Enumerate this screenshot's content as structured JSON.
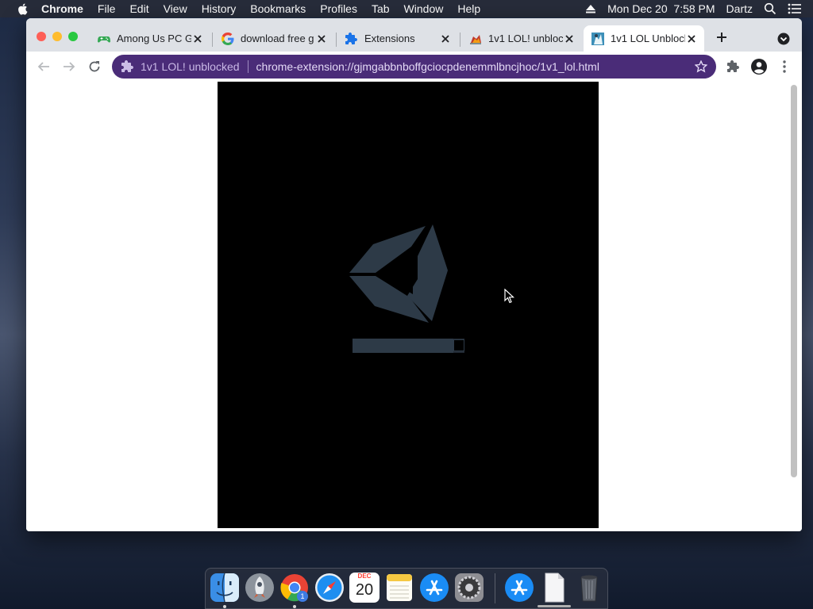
{
  "menubar": {
    "app_name": "Chrome",
    "menus": [
      "File",
      "Edit",
      "View",
      "History",
      "Bookmarks",
      "Profiles",
      "Tab",
      "Window",
      "Help"
    ],
    "clock": "Mon Dec 20  7:58 PM",
    "user": "Dartz"
  },
  "browser": {
    "tabs": [
      {
        "title": "Among Us PC G",
        "favicon": "gamepad-icon",
        "active": false
      },
      {
        "title": "download free g",
        "favicon": "google-icon",
        "active": false
      },
      {
        "title": "Extensions",
        "favicon": "puzzle-icon",
        "active": false
      },
      {
        "title": "1v1 LOL! unbloc",
        "favicon": "game-thumbnail-icon",
        "active": false
      },
      {
        "title": "1v1 LOL Unblock",
        "favicon": "game-thumbnail-icon",
        "active": true
      }
    ],
    "omnibox": {
      "chip": "1v1 LOL! unblocked",
      "url": "chrome-extension://gjmgabbnboffgciocpdenemmlbncjhoc/1v1_lol.html"
    }
  },
  "page": {
    "loader": {
      "logo": "unity-logo",
      "progress": 0.9
    }
  },
  "dock": {
    "apps": [
      "finder",
      "launchpad",
      "chrome",
      "safari",
      "calendar",
      "notes",
      "app-store",
      "system-preferences",
      "app-store-downloads",
      "document",
      "trash"
    ],
    "calendar": {
      "month": "DEC",
      "day": "20"
    },
    "chrome_badge": "1"
  },
  "colors": {
    "omnibox_bg": "#4a2c78",
    "game_bg": "#000000",
    "logo": "#2d3a47"
  }
}
